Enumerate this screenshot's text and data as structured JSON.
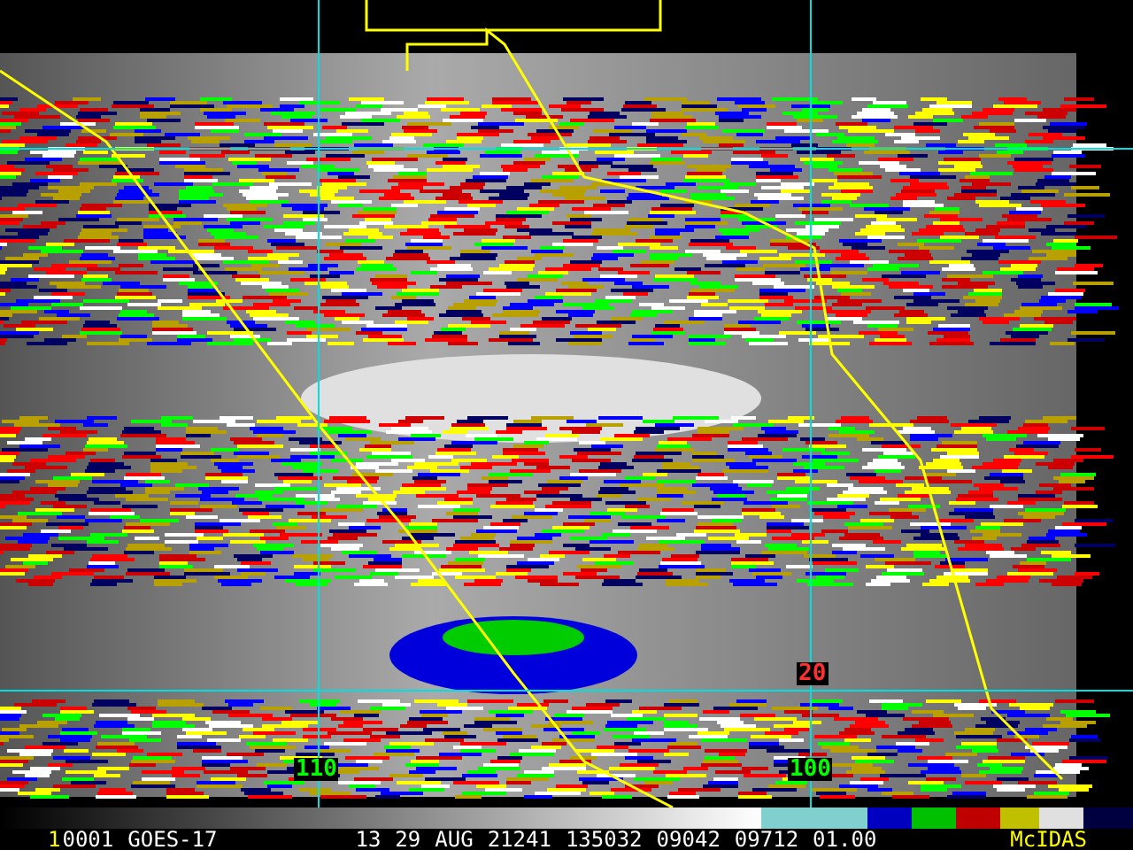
{
  "map_labels": [
    {
      "text": "20",
      "kind": "latitude"
    },
    {
      "text": "110",
      "kind": "longitude"
    },
    {
      "text": "100",
      "kind": "longitude"
    }
  ],
  "status_bar": {
    "frame": "1",
    "fields": [
      "0001",
      "GOES-17",
      "13",
      "29",
      "AUG",
      "21241",
      "135032",
      "09042",
      "09712",
      "01.00"
    ],
    "brand": "McIDAS"
  }
}
